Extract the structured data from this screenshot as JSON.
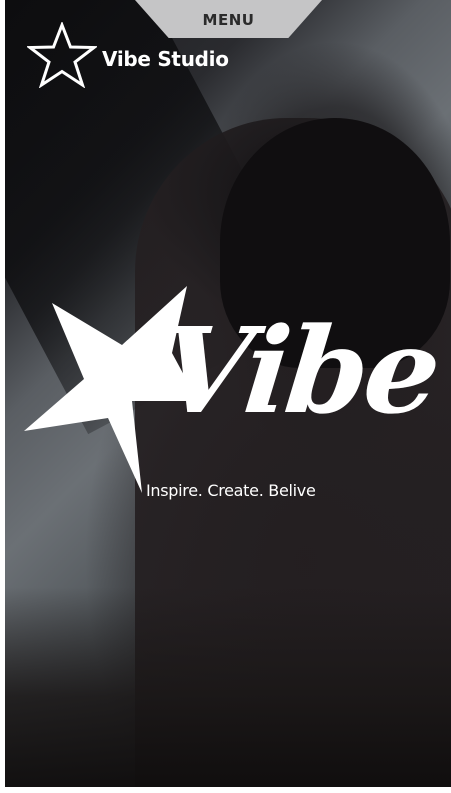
{
  "nav": {
    "menu_label": "MENU"
  },
  "brand": {
    "name": "Vibe Studio",
    "icon": "star-outline-icon"
  },
  "hero": {
    "logo_word": "Vibe",
    "logo_icon": "star-solid-icon",
    "tagline": "Inspire. Create. Belive"
  },
  "colors": {
    "menu_tab": "#c5c5c6",
    "menu_text": "#2b2b2b",
    "brand_text": "#ffffff",
    "overlay": "#1a1a1c"
  }
}
